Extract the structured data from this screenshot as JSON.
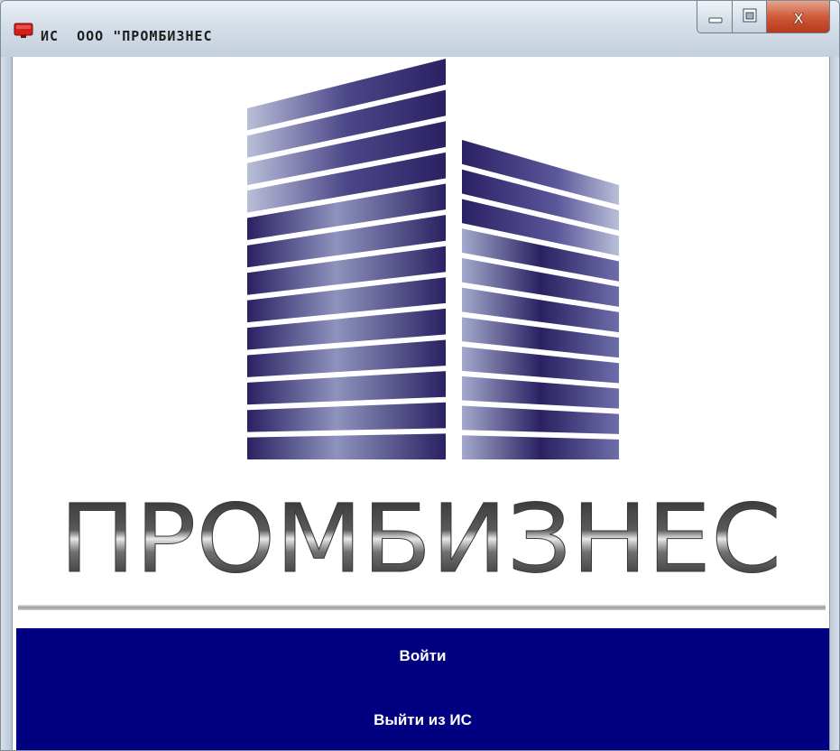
{
  "window": {
    "title": "ИС  ООО \"ПРОМБИЗНЕС",
    "controls": {
      "minimize": "minimize",
      "maximize": "maximize",
      "close": "X"
    }
  },
  "logo": {
    "wordmark": "ПРОМБИЗНЕС",
    "building_color": "#2d2466"
  },
  "menu": {
    "background": "#000080",
    "login_label": "Войти",
    "exit_label": "Выйти из ИС"
  },
  "icons": {
    "app": "app-window-icon",
    "minimize": "minimize-icon",
    "maximize": "maximize-icon",
    "close": "close-icon"
  }
}
